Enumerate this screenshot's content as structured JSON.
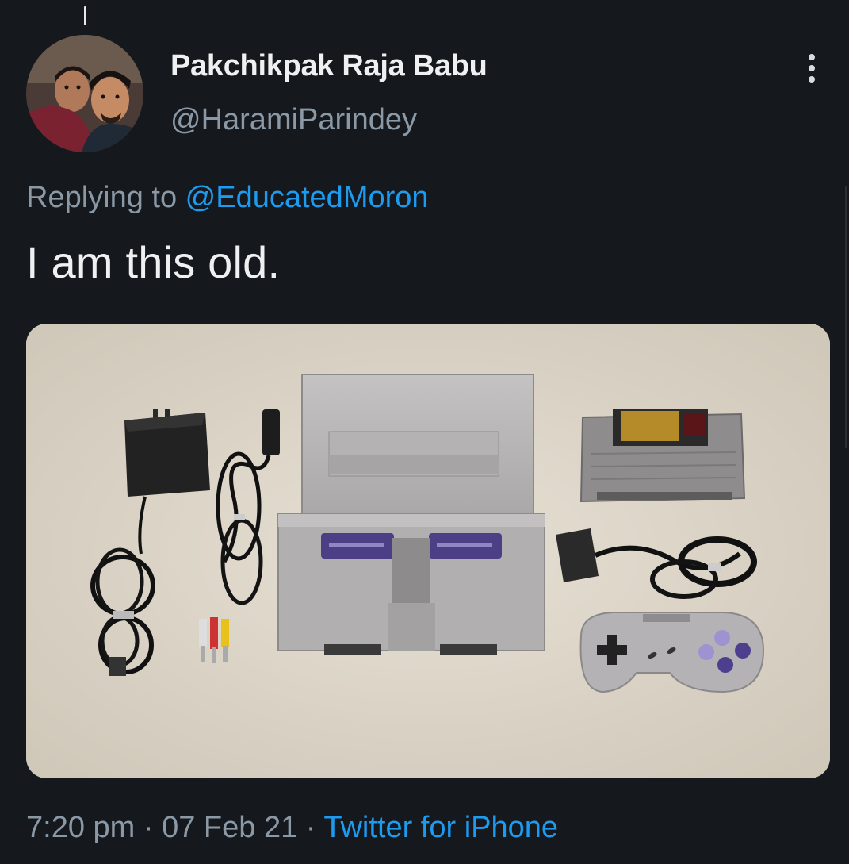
{
  "tweet": {
    "display_name": "Pakchikpak Raja Babu",
    "handle": "@HaramiParindey",
    "replying_prefix": "Replying to ",
    "replying_to": "@EducatedMoron",
    "text": "I am this old.",
    "time": "7:20 pm",
    "separator": " · ",
    "date": "07 Feb 21",
    "source": "Twitter for iPhone"
  },
  "icons": {
    "more": "more-vertical-icon"
  },
  "colors": {
    "background": "#15181c",
    "primary_text": "#eef0f1",
    "secondary_text": "#8b98a5",
    "link": "#1d9bf0"
  }
}
